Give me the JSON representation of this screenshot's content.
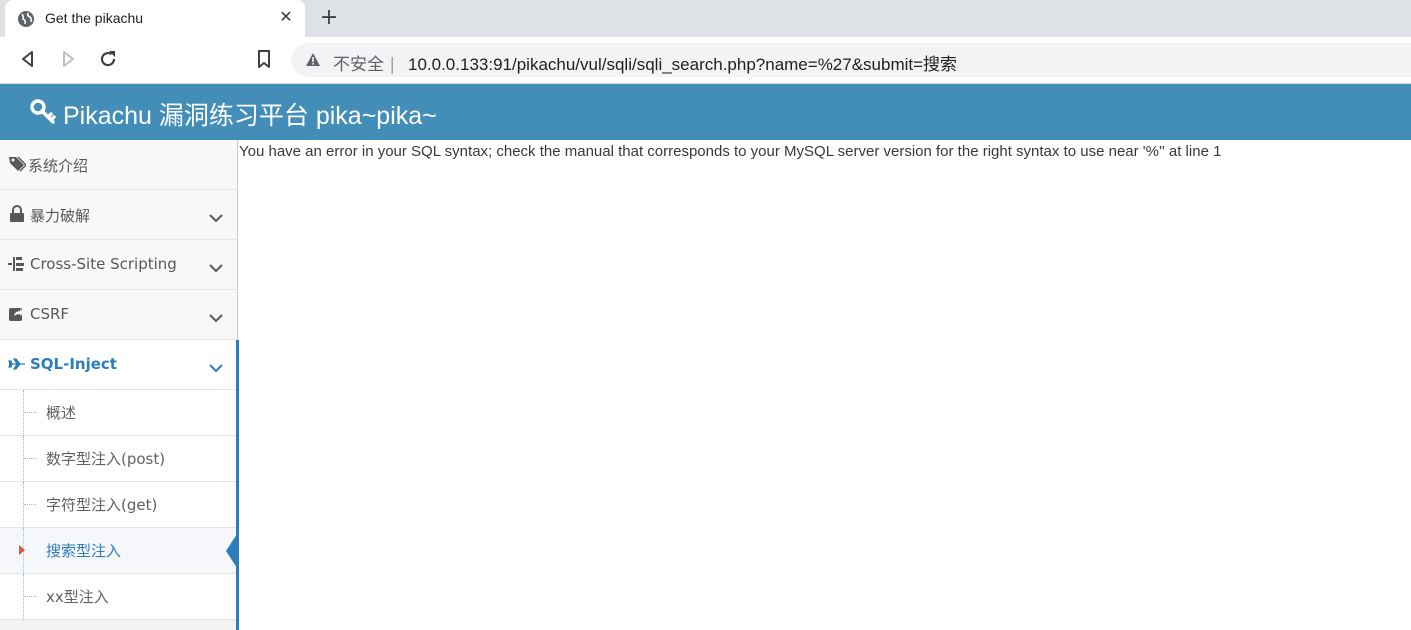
{
  "browser": {
    "tab_title": "Get the pikachu",
    "tab_close": "✕",
    "new_tab": "+",
    "security_label": "不安全",
    "url": "10.0.0.133:91/pikachu/vul/sqli/sqli_search.php?name=%27&submit=搜索"
  },
  "header": {
    "title": "Pikachu 漏洞练习平台 pika~pika~",
    "color": "#438eb9"
  },
  "sidebar": {
    "items": [
      {
        "label": "系统介绍",
        "icon": "tags-icon"
      },
      {
        "label": "暴力破解",
        "icon": "lock-icon"
      },
      {
        "label": "Cross-Site Scripting",
        "icon": "sitemap-icon"
      },
      {
        "label": "CSRF",
        "icon": "share-icon"
      },
      {
        "label": "SQL-Inject",
        "icon": "plane-icon"
      }
    ],
    "submenu": [
      {
        "label": "概述"
      },
      {
        "label": "数字型注入(post)"
      },
      {
        "label": "字符型注入(get)"
      },
      {
        "label": "搜索型注入"
      },
      {
        "label": "xx型注入"
      }
    ],
    "active_color": "#2b7dbc"
  },
  "main": {
    "error_message": "You have an error in your SQL syntax; check the manual that corresponds to your MySQL server version for the right syntax to use near '%'' at line 1"
  }
}
